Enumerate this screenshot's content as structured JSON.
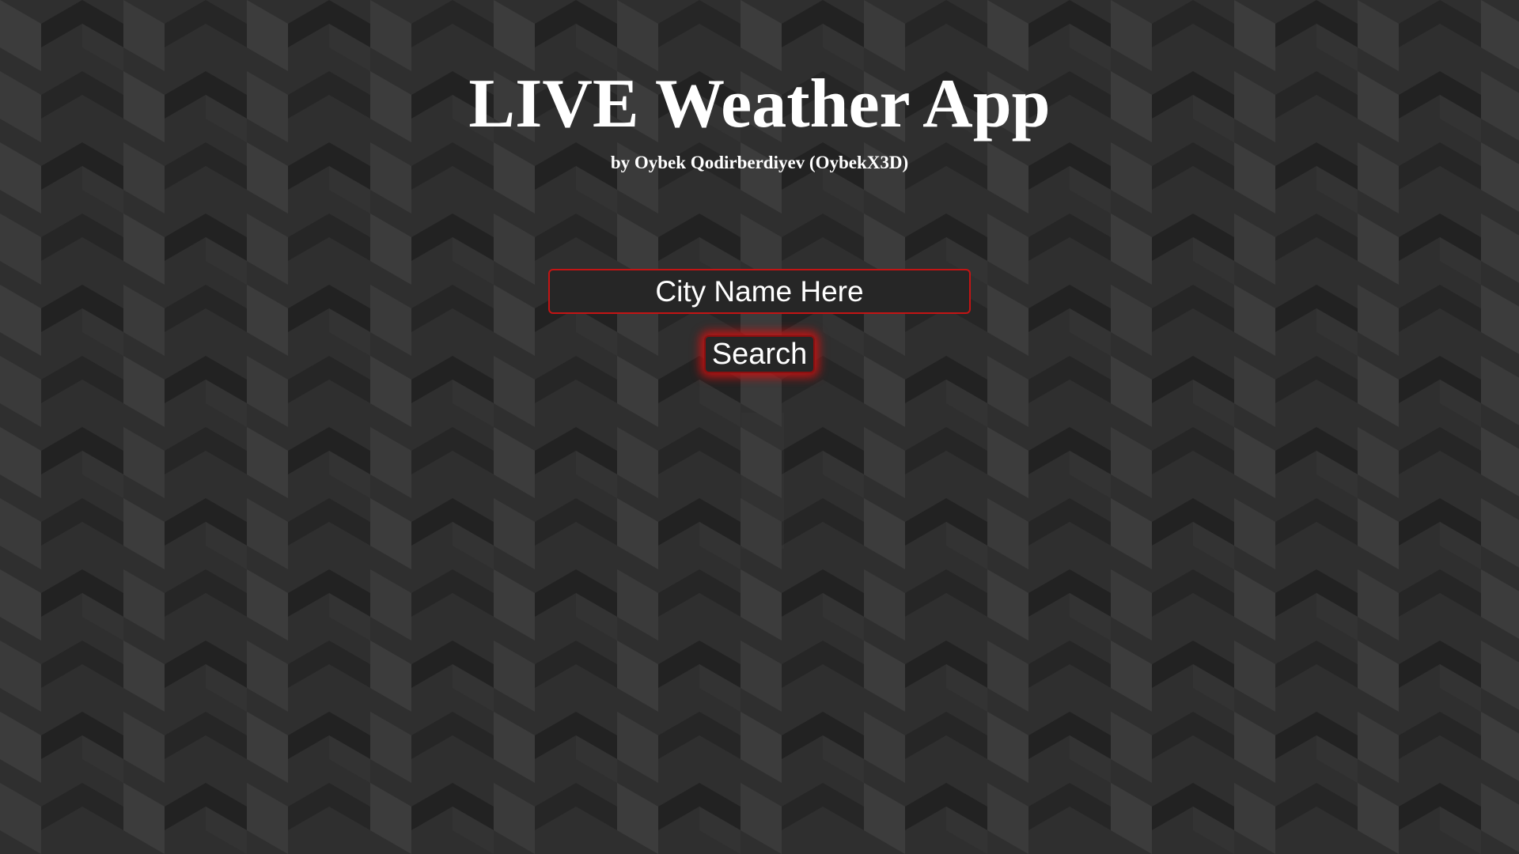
{
  "page": {
    "title": "LIVE Weather App",
    "subtitle": "by Oybek Qodirberdiyev (OybekX3D)"
  },
  "search": {
    "placeholder": "City Name Here",
    "value": "",
    "button_label": "Search"
  },
  "colors": {
    "background_dark": "#222222",
    "background_mid": "#2f2f2f",
    "background_light": "#3c3c3c",
    "accent_red": "#c41414",
    "text": "#ffffff"
  }
}
